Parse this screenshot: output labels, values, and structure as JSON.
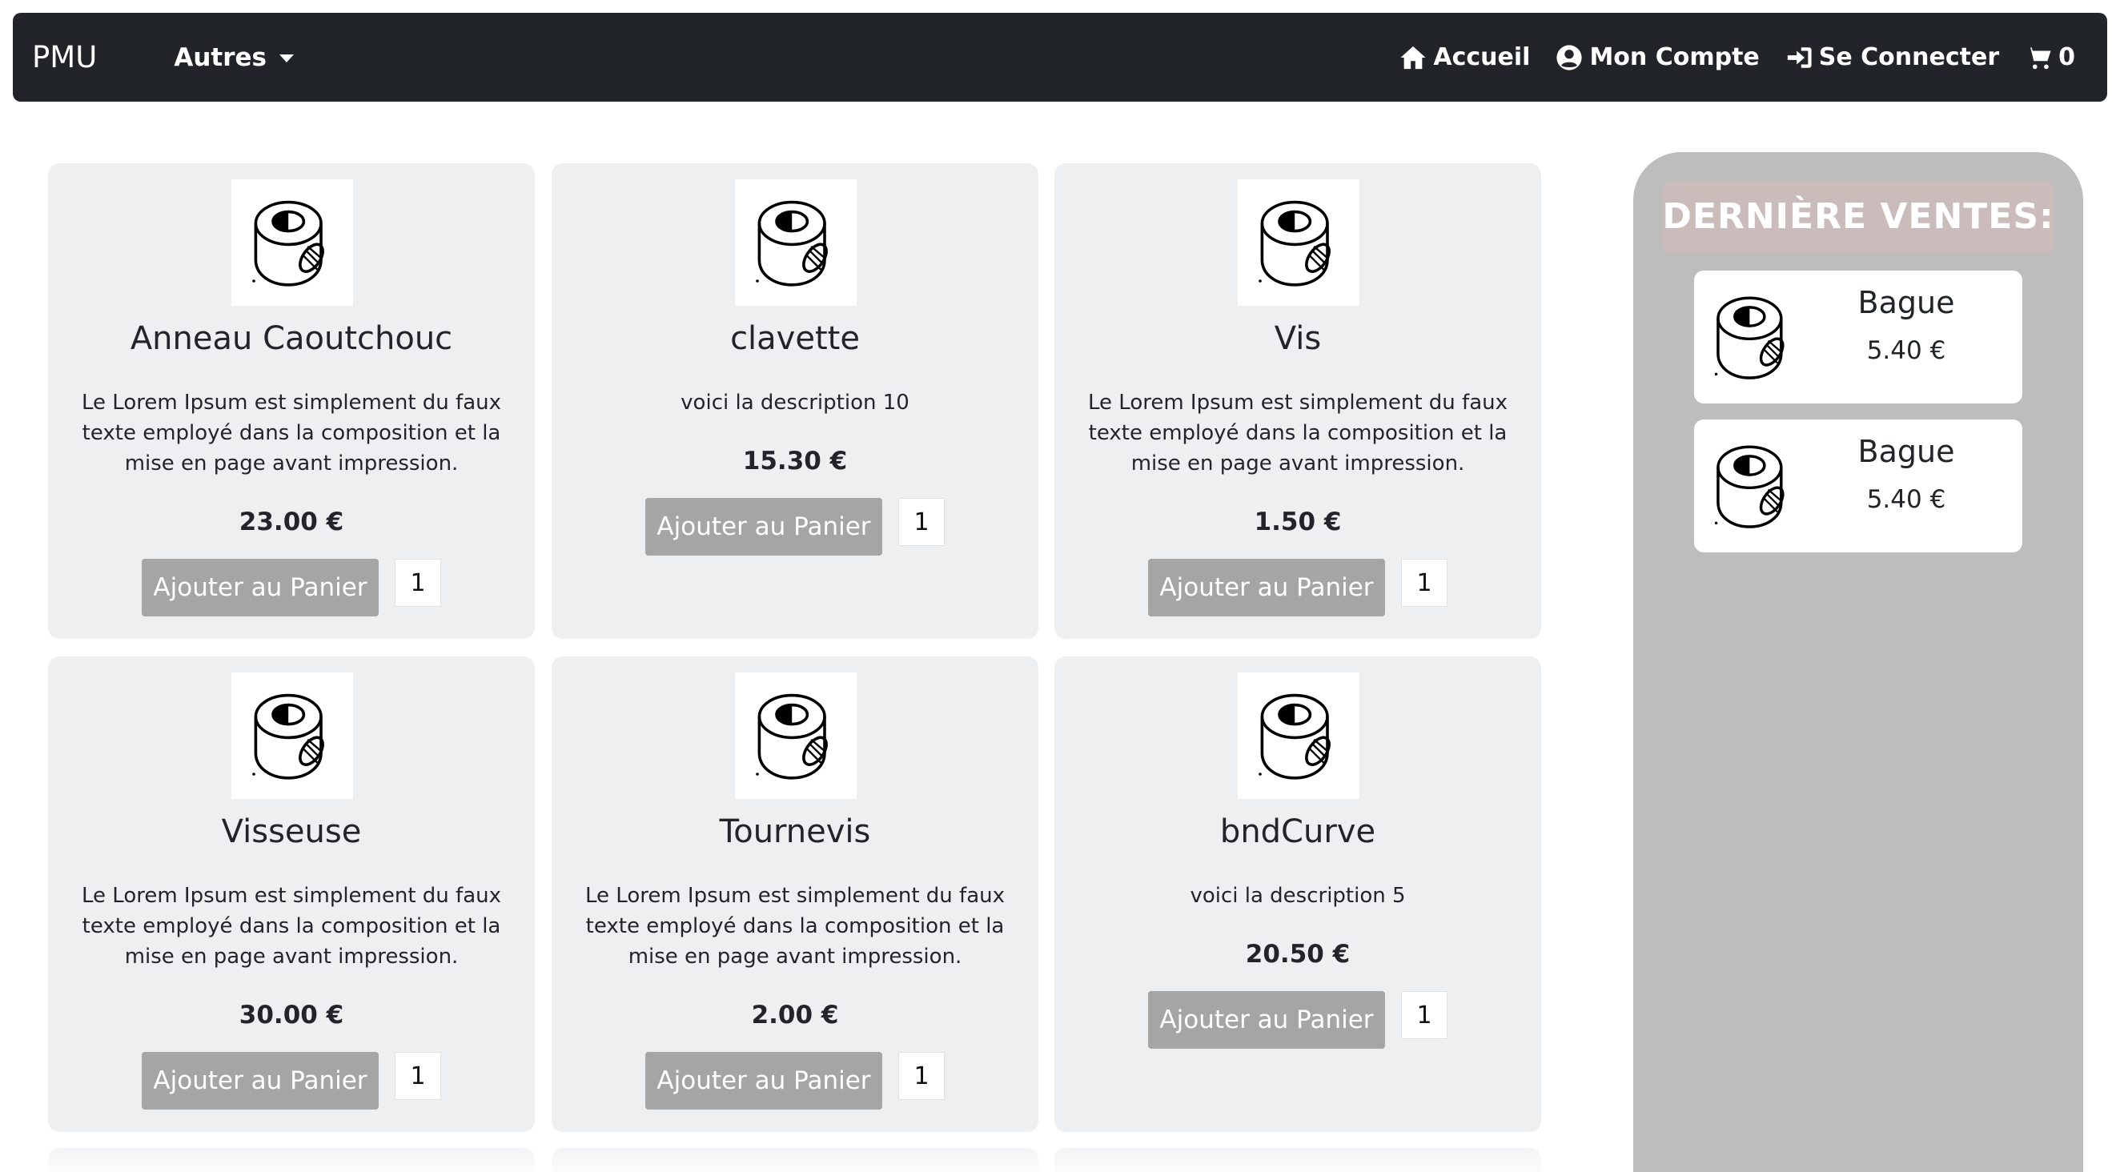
{
  "navbar": {
    "brand": "PMU",
    "dropdown_label": "Autres",
    "links": {
      "home": "Accueil",
      "account": "Mon Compte",
      "login": "Se Connecter",
      "cart_count": "0"
    }
  },
  "products": [
    {
      "name": "Anneau Caoutchouc",
      "description": "Le Lorem Ipsum est simplement du faux texte employé dans la composition et la mise en page avant impression.",
      "price": "23.00 €",
      "button": "Ajouter au Panier",
      "qty": "1"
    },
    {
      "name": "clavette",
      "description": "voici la description 10",
      "price": "15.30 €",
      "button": "Ajouter au Panier",
      "qty": "1"
    },
    {
      "name": "Vis",
      "description": "Le Lorem Ipsum est simplement du faux texte employé dans la composition et la mise en page avant impression.",
      "price": "1.50 €",
      "button": "Ajouter au Panier",
      "qty": "1"
    },
    {
      "name": "Visseuse",
      "description": "Le Lorem Ipsum est simplement du faux texte employé dans la composition et la mise en page avant impression.",
      "price": "30.00 €",
      "button": "Ajouter au Panier",
      "qty": "1"
    },
    {
      "name": "Tournevis",
      "description": "Le Lorem Ipsum est simplement du faux texte employé dans la composition et la mise en page avant impression.",
      "price": "2.00 €",
      "button": "Ajouter au Panier",
      "qty": "1"
    },
    {
      "name": "bndCurve",
      "description": "voici la description 5",
      "price": "20.50 €",
      "button": "Ajouter au Panier",
      "qty": "1"
    }
  ],
  "sidebar": {
    "title": "DERNIÈRE VENTES:",
    "sales": [
      {
        "name": "Bague",
        "price": "5.40 €"
      },
      {
        "name": "Bague",
        "price": "5.40 €"
      }
    ]
  },
  "icons": {
    "home": "home-icon",
    "account": "user-circle-icon",
    "login": "sign-in-icon",
    "cart": "shopping-cart-icon",
    "product_image": "product-roll-image"
  },
  "colors": {
    "navbar": "#212529",
    "card": "#eeeff1",
    "button": "#a5a5a5",
    "sidebar": "#bdbdbd",
    "sidebar_title": "#cbbcbc"
  }
}
